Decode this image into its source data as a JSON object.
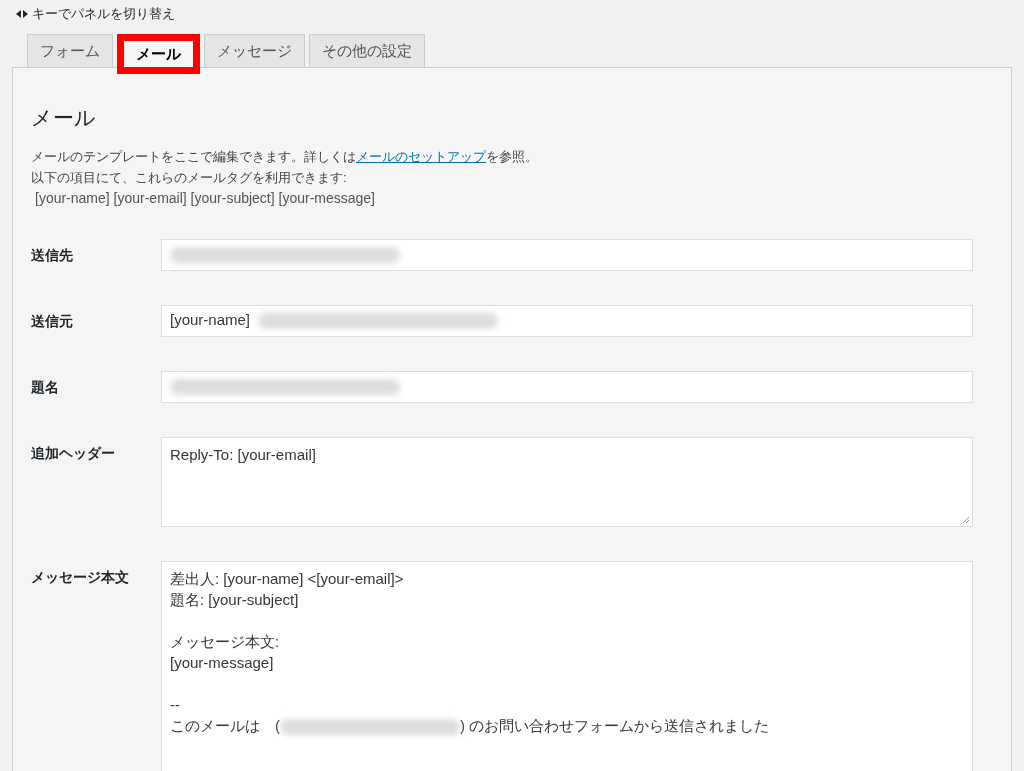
{
  "hint": {
    "text": "キーでパネルを切り替え"
  },
  "tabs": [
    {
      "label": "フォーム",
      "selected": false,
      "highlighted": false
    },
    {
      "label": "メール",
      "selected": true,
      "highlighted": true
    },
    {
      "label": "メッセージ",
      "selected": false,
      "highlighted": false
    },
    {
      "label": "その他の設定",
      "selected": false,
      "highlighted": false
    }
  ],
  "panel": {
    "title": "メール",
    "description_before": "メールのテンプレートをここで編集できます。詳しくは",
    "description_link": "メールのセットアップ",
    "description_after": "を参照。",
    "tags_intro": "以下の項目にて、これらのメールタグを利用できます:",
    "tags": "[your-name] [your-email] [your-subject] [your-message]"
  },
  "fields": [
    {
      "label": "送信先",
      "kind": "input",
      "redacted": true
    },
    {
      "label": "送信元",
      "kind": "input",
      "value": "[your-name]",
      "redacted": true
    },
    {
      "label": "題名",
      "kind": "input",
      "redacted": true
    },
    {
      "label": "追加ヘッダー",
      "kind": "textarea",
      "lines": [
        {
          "text": "Reply-To: [your-email]"
        }
      ]
    },
    {
      "label": "メッセージ本文",
      "kind": "textarea",
      "tall": true,
      "lines": [
        {
          "text": "差出人: [your-name] <[your-email]>"
        },
        {
          "text": "題名: [your-subject]"
        },
        {
          "text": "メッセージ本文:",
          "gap_before": true
        },
        {
          "text": "[your-message]"
        },
        {
          "text": "--",
          "gap_before": true
        },
        {
          "text": "このメールは　(",
          "redacted": true,
          "after": ") のお問い合わせフォームから送信されました"
        }
      ]
    }
  ]
}
